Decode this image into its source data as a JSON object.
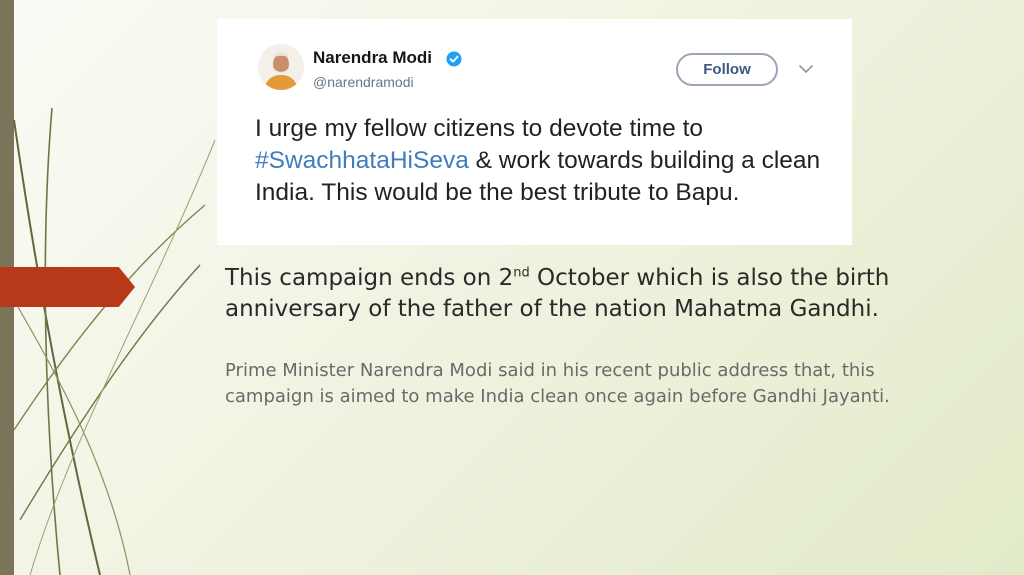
{
  "tweet": {
    "author_name": "Narendra Modi",
    "author_handle": "@narendramodi",
    "follow_label": "Follow",
    "text_before": "I urge my fellow citizens to devote time to ",
    "hashtag": "#SwachhataHiSeva",
    "text_after": " & work towards building a clean India. This would be the best tribute to Bapu.",
    "colors": {
      "hashtag": "#3f7dbd",
      "verified": "#1da1f2"
    }
  },
  "slide": {
    "main_text_part1": "This campaign ends on 2",
    "main_text_sup": "nd",
    "main_text_part2": " October which is also the birth anniversary of the father of the nation Mahatma Gandhi.",
    "sub_text": "Prime Minister Narendra Modi said in his recent public address that, this campaign is aimed to make India clean once again before Gandhi Jayanti.",
    "colors": {
      "accent_arrow": "#b8391a",
      "left_bar": "#7a7458"
    }
  }
}
